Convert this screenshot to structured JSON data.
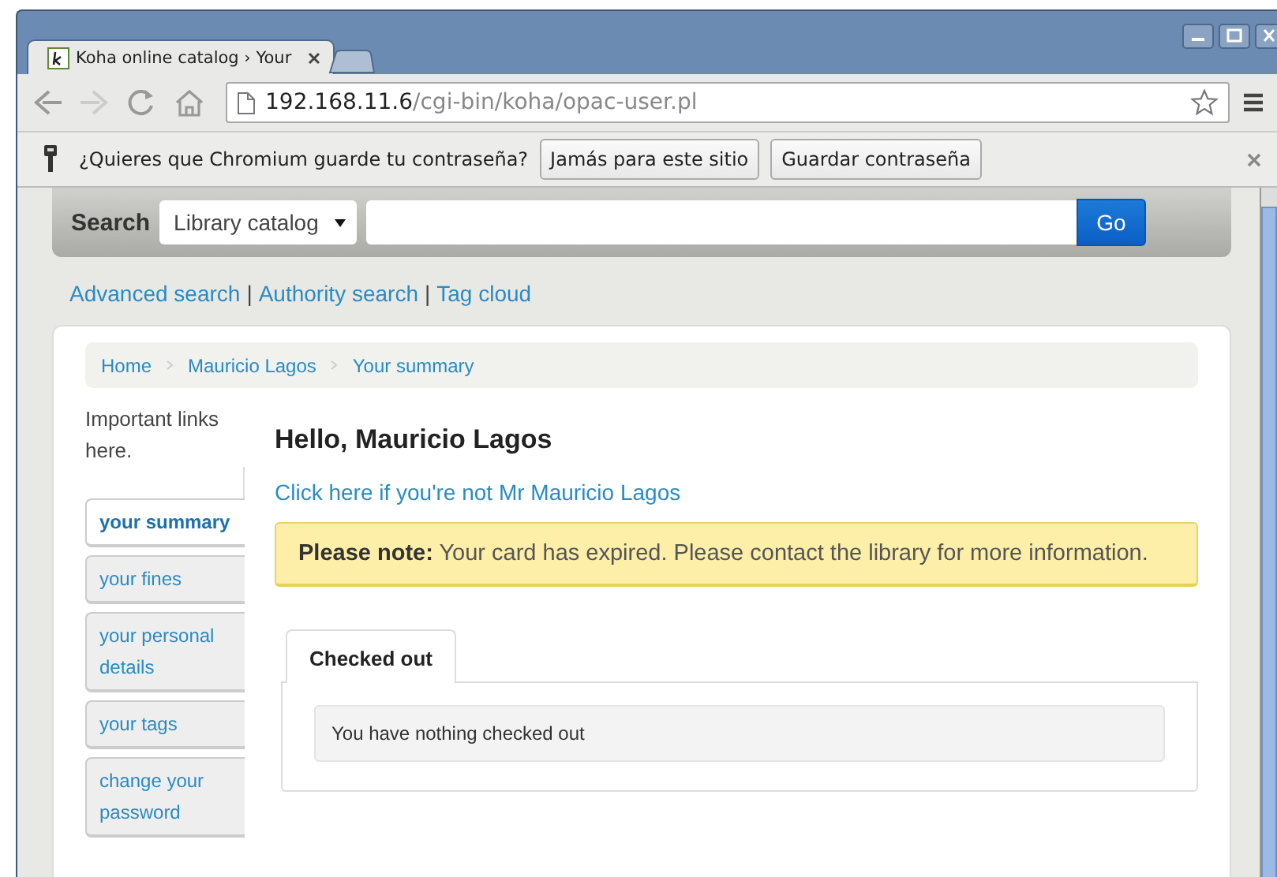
{
  "browser_tabs": [
    {
      "title": "Koha online catalog › Your",
      "selected": true
    }
  ],
  "address_bar": {
    "host": "192.168.11.6",
    "path": "/cgi-bin/koha/opac-user.pl"
  },
  "password_bar": {
    "message": "¿Quieres que Chromium guarde tu contraseña?",
    "buttons": [
      "Jamás para este sitio",
      "Guardar contraseña"
    ]
  },
  "search": {
    "label": "Search",
    "scope": "Library catalog",
    "button": "Go"
  },
  "links": {
    "items": [
      "Advanced search",
      "Authority search",
      "Tag cloud"
    ],
    "separator": "|"
  },
  "breadcrumb": [
    "Home",
    "Mauricio Lagos",
    "Your summary"
  ],
  "sidebar": {
    "intro": "Important links here.",
    "items": [
      {
        "label": "your summary",
        "selected": true
      },
      {
        "label": "your fines",
        "selected": false
      },
      {
        "label": "your personal details",
        "selected": false
      },
      {
        "label": "your tags",
        "selected": false
      },
      {
        "label": "change your password",
        "selected": false
      }
    ]
  },
  "greeting": "Hello, Mauricio Lagos",
  "not_me_link": "Click here if you're not Mr Mauricio Lagos",
  "alert": "**Please note:** Your card has expired. Please contact the library for more information.",
  "content_tabs": [
    {
      "label": "Checked out",
      "selected": true
    }
  ],
  "message": "You have nothing checked out"
}
